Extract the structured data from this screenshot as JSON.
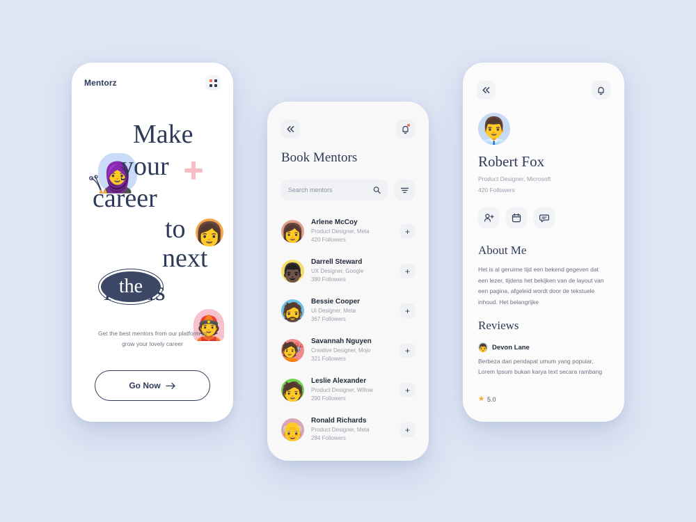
{
  "theme": {
    "background": "#dee5f4",
    "ink": "#2e3a59",
    "muted": "#9aa1ad",
    "accent_orange": "#f4714e",
    "accent_pink": "#f7bcc5",
    "star": "#f5a623"
  },
  "screen1": {
    "brand": "Mentorz",
    "grid_icon": "grid-menu-icon",
    "headline": {
      "l1": "Make",
      "l2": "your",
      "l3": "career",
      "l4": "to",
      "l5": "next",
      "l6": "levels",
      "badge": "the"
    },
    "decor": {
      "avatar_1": "🧕",
      "avatar_2": "👩",
      "avatar_3": "👲",
      "plus": "plus-decoration",
      "swirl": "swirl-crown-decoration"
    },
    "subtitle": "Get the best mentors from our platform to grow your lovely career",
    "cta_label": "Go Now"
  },
  "screen2": {
    "back_icon": "double-chevron-left-icon",
    "bell_icon": "bell-icon",
    "title": "Book Mentors",
    "search": {
      "placeholder": "Search mentors",
      "value": "",
      "icon": "search-icon"
    },
    "filter_icon": "filter-icon",
    "add_label": "+",
    "mentors": [
      {
        "name": "Arlene McCoy",
        "role": "Product Designer, Meta",
        "followers": "420 Followers",
        "avatar_bg": "#e0a08c",
        "emoji": "👩"
      },
      {
        "name": "Darrell Steward",
        "role": "UX Designer, Google",
        "followers": "380 Followers",
        "avatar_bg": "#f2de6a",
        "emoji": "👨🏿"
      },
      {
        "name": "Bessie Cooper",
        "role": "UI Designer, Meta",
        "followers": "367 Followers",
        "avatar_bg": "#6ec1e4",
        "emoji": "🧔"
      },
      {
        "name": "Savannah Nguyen",
        "role": "Creative Designer, Mojo",
        "followers": "321 Followers",
        "avatar_bg": "#f08a8a",
        "emoji": "💇"
      },
      {
        "name": "Leslie Alexander",
        "role": "Product Designer, Willow",
        "followers": "290 Followers",
        "avatar_bg": "#6ed24f",
        "emoji": "🧑"
      },
      {
        "name": "Ronald Richards",
        "role": "Product Designer, Meta",
        "followers": "284 Followers",
        "avatar_bg": "#d9a4b8",
        "emoji": "👴"
      }
    ]
  },
  "screen3": {
    "back_icon": "double-chevron-left-icon",
    "bell_icon": "bell-icon",
    "avatar_emoji": "👨‍💼",
    "name": "Robert Fox",
    "role": "Product Designer, Microsoft",
    "followers": "420 Followers",
    "actions": [
      {
        "name": "add-person-icon"
      },
      {
        "name": "calendar-icon"
      },
      {
        "name": "message-icon"
      }
    ],
    "about_heading": "About Me",
    "about_text": "Het is al geruime tijd een bekend gegeven dat een lezer, tijdens het bekijken van de layout van een pagina, afgeleid wordt door de tekstuele inhoud. Het belangrijke",
    "reviews_heading": "Reviews",
    "review": {
      "avatar_emoji": "👨",
      "author": "Devon Lane",
      "text": "Berbeza dari pendapat umum yang popular, Lorem Ipsum bukan karya text secara rambang",
      "rating": "5.0",
      "star_icon": "star-icon"
    }
  }
}
